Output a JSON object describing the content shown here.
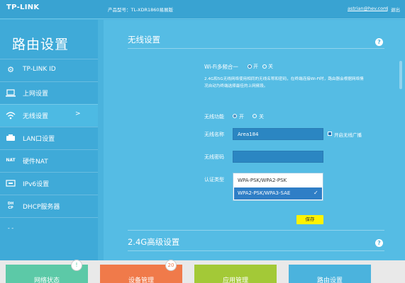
{
  "topbar": {
    "logo": "TP-LINK",
    "model": "产品型号：TL-XDR1860易展版",
    "user": "astrian@hev.com",
    "separator": "|",
    "logout": "退出"
  },
  "sidebar": {
    "title": "路由设置",
    "items": [
      {
        "label": "TP-LINK ID",
        "icon": "gear-icon"
      },
      {
        "label": "上网设置",
        "icon": "laptop-icon"
      },
      {
        "label": "无线设置",
        "icon": "wifi-icon",
        "arrow": ">"
      },
      {
        "label": "LAN口设置",
        "icon": "lan-icon"
      },
      {
        "label": "硬件NAT",
        "icon": "nat-icon"
      },
      {
        "label": "IPv6设置",
        "icon": "ipv6-icon"
      },
      {
        "label": "DHCP服务器",
        "icon": "dhcp-icon"
      }
    ]
  },
  "main": {
    "section1_title": "无线设置",
    "wifi_multi_label": "Wi-Fi多频合一",
    "on": "开",
    "off": "关",
    "description": "2.4G和5G无线网络使用相同的无线名称和密码，在终端连接Wi-Fi时，路由器会根据网络情况自动为终端选择最佳的上网频段。",
    "wireless_func_label": "无线功能",
    "ssid_label": "无线名称",
    "ssid_value": "Area184",
    "broadcast_label": "开启无线广播",
    "password_label": "无线密码",
    "auth_label": "认证类型",
    "auth_options": [
      "WPA-PSK/WPA2-PSK",
      "WPA2-PSK/WPA3-SAE"
    ],
    "checkmark": "✓",
    "save_label": "保存",
    "section2_title": "2.4G高级设置",
    "help": "?"
  },
  "bottom": {
    "tiles": [
      {
        "label": "网络状态",
        "color": "#5cc9a7",
        "badge": "!"
      },
      {
        "label": "设备管理",
        "color": "#f07a4a",
        "badge": "20"
      },
      {
        "label": "应用管理",
        "color": "#a3c937"
      },
      {
        "label": "路由设置",
        "color": "#4bb3dd"
      }
    ]
  }
}
